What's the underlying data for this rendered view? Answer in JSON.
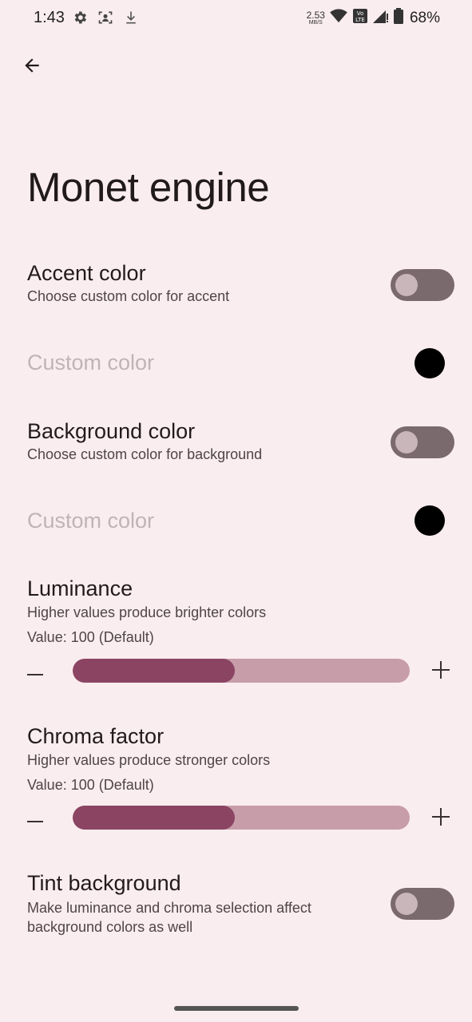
{
  "status_bar": {
    "time": "1:43",
    "net_speed_value": "2.53",
    "net_speed_unit": "MB/S",
    "battery": "68%",
    "icons": [
      "gear-icon",
      "face-scan-icon",
      "download-icon",
      "wifi-icon",
      "volte-icon",
      "signal-icon",
      "battery-icon"
    ]
  },
  "header": {
    "back_icon": "arrow-left-icon",
    "title": "Monet engine"
  },
  "settings": {
    "accent": {
      "title": "Accent color",
      "subtitle": "Choose custom color for accent",
      "enabled": false
    },
    "accent_custom": {
      "title": "Custom color",
      "color": "#000000"
    },
    "background": {
      "title": "Background color",
      "subtitle": "Choose custom color for background",
      "enabled": false
    },
    "background_custom": {
      "title": "Custom color",
      "color": "#000000"
    },
    "luminance": {
      "title": "Luminance",
      "subtitle": "Higher values produce brighter colors",
      "value_label": "Value: 100 (Default)",
      "fraction": 0.48
    },
    "chroma": {
      "title": "Chroma factor",
      "subtitle": "Higher values produce stronger colors",
      "value_label": "Value: 100 (Default)",
      "fraction": 0.48
    },
    "tint": {
      "title": "Tint background",
      "subtitle": "Make luminance and chroma selection affect background colors as well",
      "enabled": false
    }
  },
  "colors": {
    "background": "#FAEDEF",
    "slider_fill": "#8B4562",
    "slider_track": "#C79DAA",
    "switch_track": "#7A6A6E",
    "switch_thumb": "#C9B6BA"
  }
}
